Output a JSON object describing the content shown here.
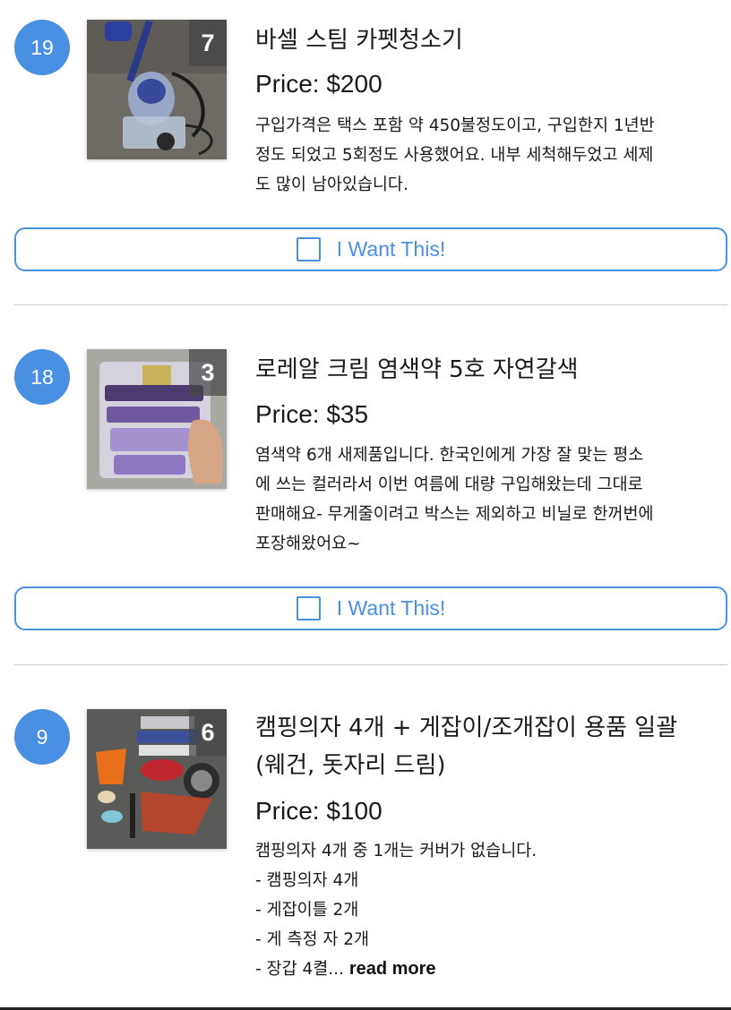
{
  "listings": [
    {
      "rank": "19",
      "photo_count": "7",
      "title": "바셀 스팀 카펫청소기",
      "price": "Price: $200",
      "description": "구입가격은 택스 포함 약 450불정도이고, 구입한지 1년반\n정도 되었고 5회정도 사용했어요. 내부 세척해두었고 세제\n도 많이 남아있습니다.",
      "button_label": "I Want This!"
    },
    {
      "rank": "18",
      "photo_count": "3",
      "title": "로레알 크림 염색약 5호 자연갈색",
      "price": "Price: $35",
      "description": "염색약 6개 새제품입니다. 한국인에게 가장 잘 맞는 평소\n에 쓰는 컬러라서 이번 여름에 대량 구입해왔는데 그대로\n판매해요- 무게줄이려고 박스는 제외하고 비닐로 한꺼번에\n포장해왔어요~",
      "button_label": "I Want This!"
    },
    {
      "rank": "9",
      "photo_count": "6",
      "title": "캠핑의자 4개 + 게잡이/조개잡이 용품 일괄\n(웨건, 돗자리 드림)",
      "price": "Price: $100",
      "description": "캠핑의자 4개 중 1개는 커버가 없습니다.\n- 캠핑의자 4개\n- 게잡이틀 2개\n- 게 측정 자 2개\n- 장갑 4켤...",
      "read_more": "read more"
    }
  ],
  "colors": {
    "accent": "#4a90e2",
    "divider": "#c8c8c8",
    "text": "#1a1a1a"
  }
}
